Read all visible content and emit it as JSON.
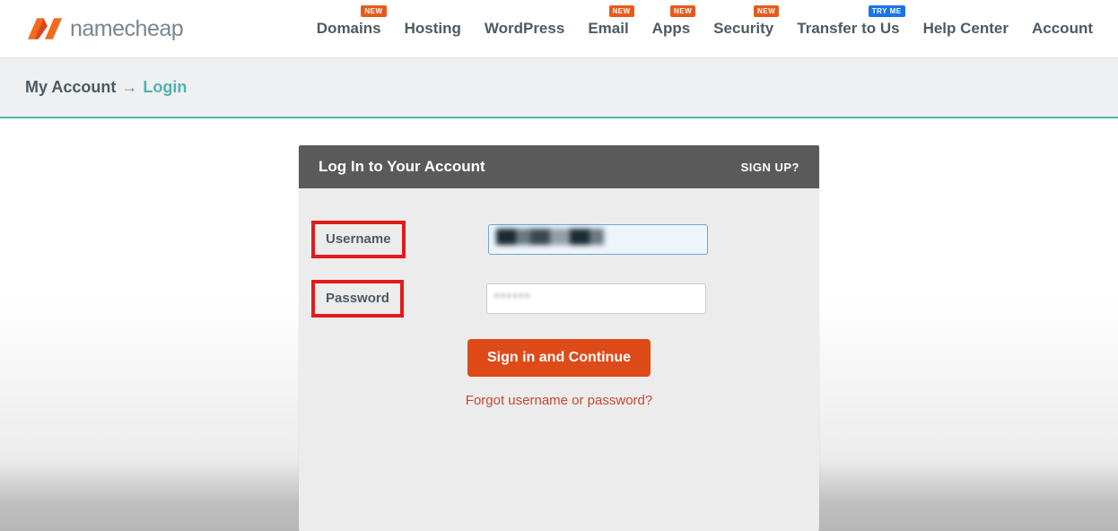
{
  "brand": {
    "name": "namecheap"
  },
  "nav": {
    "items": [
      {
        "label": "Domains",
        "badge": "NEW",
        "badgeClass": "new"
      },
      {
        "label": "Hosting",
        "badge": "",
        "badgeClass": ""
      },
      {
        "label": "WordPress",
        "badge": "",
        "badgeClass": ""
      },
      {
        "label": "Email",
        "badge": "NEW",
        "badgeClass": "new"
      },
      {
        "label": "Apps",
        "badge": "NEW",
        "badgeClass": "new"
      },
      {
        "label": "Security",
        "badge": "NEW",
        "badgeClass": "new"
      },
      {
        "label": "Transfer to Us",
        "badge": "TRY ME",
        "badgeClass": "tryme"
      },
      {
        "label": "Help Center",
        "badge": "",
        "badgeClass": ""
      },
      {
        "label": "Account",
        "badge": "",
        "badgeClass": ""
      }
    ]
  },
  "breadcrumb": {
    "root": "My Account",
    "sep": "→",
    "current": "Login"
  },
  "login": {
    "title": "Log In to Your Account",
    "signup": "SIGN UP?",
    "username_label": "Username",
    "password_label": "Password",
    "password_mask": "••••••",
    "signin_button": "Sign in and Continue",
    "forgot_link": "Forgot username or password?"
  }
}
